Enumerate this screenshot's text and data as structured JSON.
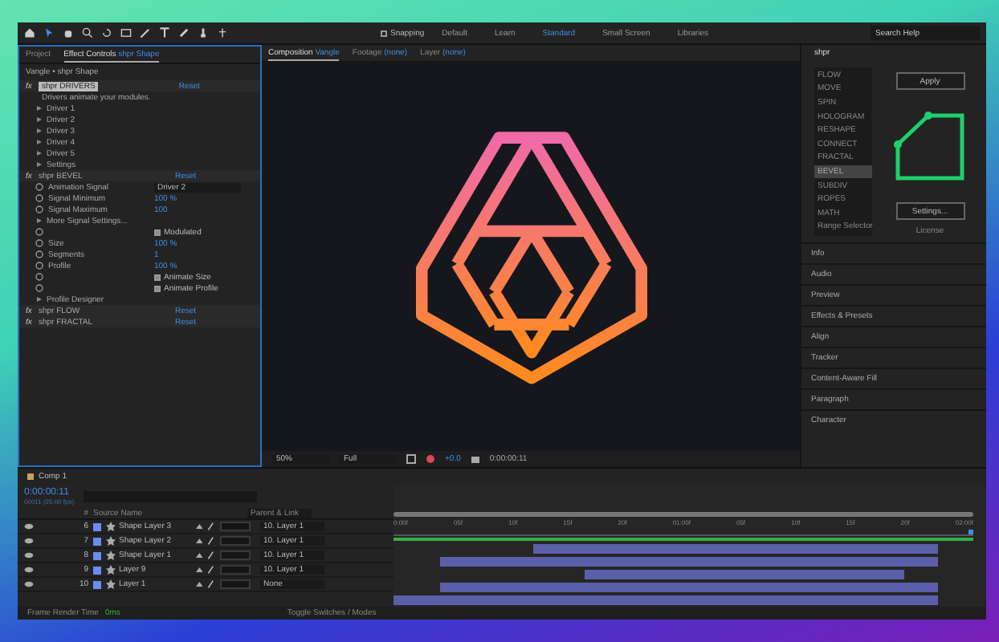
{
  "toolbar": {
    "snapping": {
      "label": "Snapping",
      "checked": false
    },
    "workspaces": [
      {
        "label": "Default",
        "selected": false
      },
      {
        "label": "Learn",
        "selected": false
      },
      {
        "label": "Standard",
        "selected": true
      },
      {
        "label": "Small Screen",
        "selected": false
      },
      {
        "label": "Libraries",
        "selected": false
      }
    ],
    "search": {
      "placeholder": "Search Help"
    }
  },
  "effect_panel": {
    "tabs": [
      {
        "label": "Project",
        "selected": false
      },
      {
        "label": "Effect Controls",
        "subject": "shpr Shape",
        "selected": true
      }
    ],
    "breadcrumb": "Vangle • shpr Shape",
    "rows": [
      {
        "kind": "header",
        "badge": "fx",
        "name": "shpr DRIVERS",
        "reset": "Reset",
        "selected": true
      },
      {
        "kind": "text",
        "name": "Drivers animate your modules."
      },
      {
        "kind": "group",
        "name": "Driver 1"
      },
      {
        "kind": "group",
        "name": "Driver 2"
      },
      {
        "kind": "group",
        "name": "Driver 3"
      },
      {
        "kind": "group",
        "name": "Driver 4"
      },
      {
        "kind": "group",
        "name": "Driver 5"
      },
      {
        "kind": "group",
        "name": "Settings"
      },
      {
        "kind": "header",
        "badge": "fx",
        "name": "shpr BEVEL",
        "reset": "Reset",
        "selected": false
      },
      {
        "kind": "dropdown",
        "name": "Animation Signal",
        "value": "Driver 2"
      },
      {
        "kind": "number",
        "name": "Signal Minimum",
        "value": "100 %"
      },
      {
        "kind": "number",
        "name": "Signal Maximum",
        "value": "100"
      },
      {
        "kind": "group",
        "name": "More Signal Settings..."
      },
      {
        "kind": "checkbox",
        "name": "Modulated",
        "checked": true
      },
      {
        "kind": "number",
        "name": "Size",
        "value": "100 %"
      },
      {
        "kind": "number",
        "name": "Segments",
        "value": "1"
      },
      {
        "kind": "number",
        "name": "Profile",
        "value": "100 %"
      },
      {
        "kind": "checkbox",
        "name": "Animate Size",
        "checked": true
      },
      {
        "kind": "checkbox",
        "name": "Animate Profile",
        "checked": true
      },
      {
        "kind": "group",
        "name": "Profile Designer"
      },
      {
        "kind": "header",
        "badge": "fx",
        "name": "shpr FLOW",
        "reset": "Reset",
        "selected": false
      },
      {
        "kind": "header",
        "badge": "fx",
        "name": "shpr FRACTAL",
        "reset": "Reset",
        "selected": false
      }
    ]
  },
  "composition_panel": {
    "tabs": [
      {
        "label": "Composition",
        "subject": "Vangle",
        "selected": true
      },
      {
        "label": "Footage",
        "subject": "(none)",
        "selected": false
      },
      {
        "label": "Layer",
        "subject": "(none)",
        "selected": false
      }
    ],
    "zoom": "50%",
    "resolution": "Full",
    "exposure": "+0.0",
    "timecode": "0:00:00:11"
  },
  "shpr_panel": {
    "title": "shpr",
    "modules": [
      {
        "label": "FLOW",
        "selected": false
      },
      {
        "label": "MOVE",
        "selected": false
      },
      {
        "label": "SPIN",
        "selected": false
      },
      {
        "label": "HOLOGRAM",
        "selected": false
      },
      {
        "label": "RESHAPE",
        "selected": false
      },
      {
        "label": "CONNECT",
        "selected": false
      },
      {
        "label": "FRACTAL",
        "selected": false
      },
      {
        "label": "BEVEL",
        "selected": true
      },
      {
        "label": "SUBDIV",
        "selected": false
      },
      {
        "label": "ROPES",
        "selected": false
      },
      {
        "label": "MATH",
        "selected": false
      },
      {
        "label": "Range Selector",
        "selected": false
      }
    ],
    "buttons": [
      "Apply",
      "Settings..."
    ],
    "license": "License"
  },
  "collapsed_panels": [
    "Info",
    "Audio",
    "Preview",
    "Effects & Presets",
    "Align",
    "Tracker",
    "Content-Aware Fill",
    "Paragraph",
    "Character"
  ],
  "timeline": {
    "tab": "Comp 1",
    "timecode": "0:00:00:11",
    "frame_info": "00011 (25.00 fps)",
    "columns": {
      "number": "#",
      "source": "Source Name",
      "parent": "Parent & Link"
    },
    "ruler": [
      "0:00f",
      "05f",
      "10f",
      "15f",
      "20f",
      "01:00f",
      "05f",
      "10f",
      "15f",
      "20f",
      "02:00f"
    ],
    "layers": [
      {
        "number": "6",
        "name": "Shape Layer 3",
        "parent": "10. Layer 1"
      },
      {
        "number": "7",
        "name": "Shape Layer 2",
        "parent": "10. Layer 1"
      },
      {
        "number": "8",
        "name": "Shape Layer 1",
        "parent": "10. Layer 1"
      },
      {
        "number": "9",
        "name": "Layer 9",
        "parent": "10. Layer 1"
      },
      {
        "number": "10",
        "name": "Layer 1",
        "parent": "None"
      }
    ],
    "status": {
      "label": "Frame Render Time",
      "value": "0ms",
      "toggle": "Toggle Switches / Modes"
    }
  }
}
